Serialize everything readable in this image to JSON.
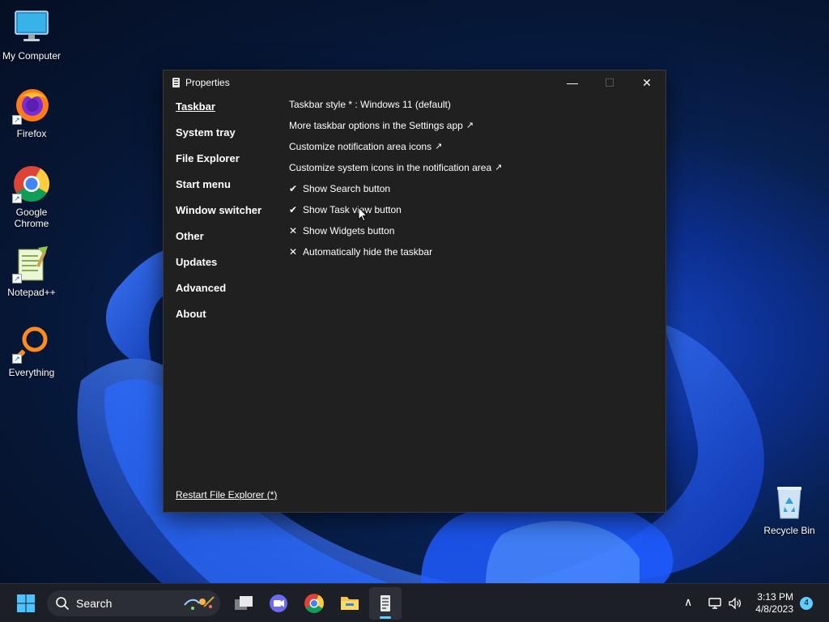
{
  "desktop": {
    "icons": [
      {
        "label": "My Computer",
        "icon": "monitor-icon"
      },
      {
        "label": "Firefox",
        "icon": "firefox-icon"
      },
      {
        "label": "Google Chrome",
        "icon": "chrome-icon"
      },
      {
        "label": "Notepad++",
        "icon": "notepadpp-icon"
      },
      {
        "label": "Everything",
        "icon": "everything-icon"
      },
      {
        "label": "Recycle Bin",
        "icon": "recycle-bin-icon"
      }
    ]
  },
  "window": {
    "title": "Properties",
    "controls": {
      "minimize": "—",
      "maximize": "☐",
      "close": "✕"
    },
    "nav": [
      {
        "label": "Taskbar",
        "active": true
      },
      {
        "label": "System tray"
      },
      {
        "label": "File Explorer"
      },
      {
        "label": "Start menu"
      },
      {
        "label": "Window switcher"
      },
      {
        "label": "Other"
      },
      {
        "label": "Updates"
      },
      {
        "label": "Advanced"
      },
      {
        "label": "About"
      }
    ],
    "options": [
      {
        "label": "Taskbar style * : Windows 11 (default)",
        "mark": "",
        "ext": ""
      },
      {
        "label": "More taskbar options in the Settings app",
        "mark": "",
        "ext": "↗"
      },
      {
        "label": "Customize notification area icons",
        "mark": "",
        "ext": "↗"
      },
      {
        "label": "Customize system icons in the notification area",
        "mark": "",
        "ext": "↗"
      },
      {
        "label": "Show Search button",
        "mark": "✔",
        "ext": ""
      },
      {
        "label": "Show Task view button",
        "mark": "✔",
        "ext": ""
      },
      {
        "label": "Show Widgets button",
        "mark": "✕",
        "ext": ""
      },
      {
        "label": "Automatically hide the taskbar",
        "mark": "✕",
        "ext": ""
      }
    ],
    "restart_link": "Restart File Explorer (*)"
  },
  "taskbar": {
    "search_label": "Search",
    "clock_time": "3:13 PM",
    "clock_date": "4/8/2023",
    "notification_count": "4",
    "tray_chevron": "∧"
  },
  "colors": {
    "accent": "#60cdff",
    "window_bg": "#202020",
    "taskbar_bg": "#1c1f26"
  }
}
